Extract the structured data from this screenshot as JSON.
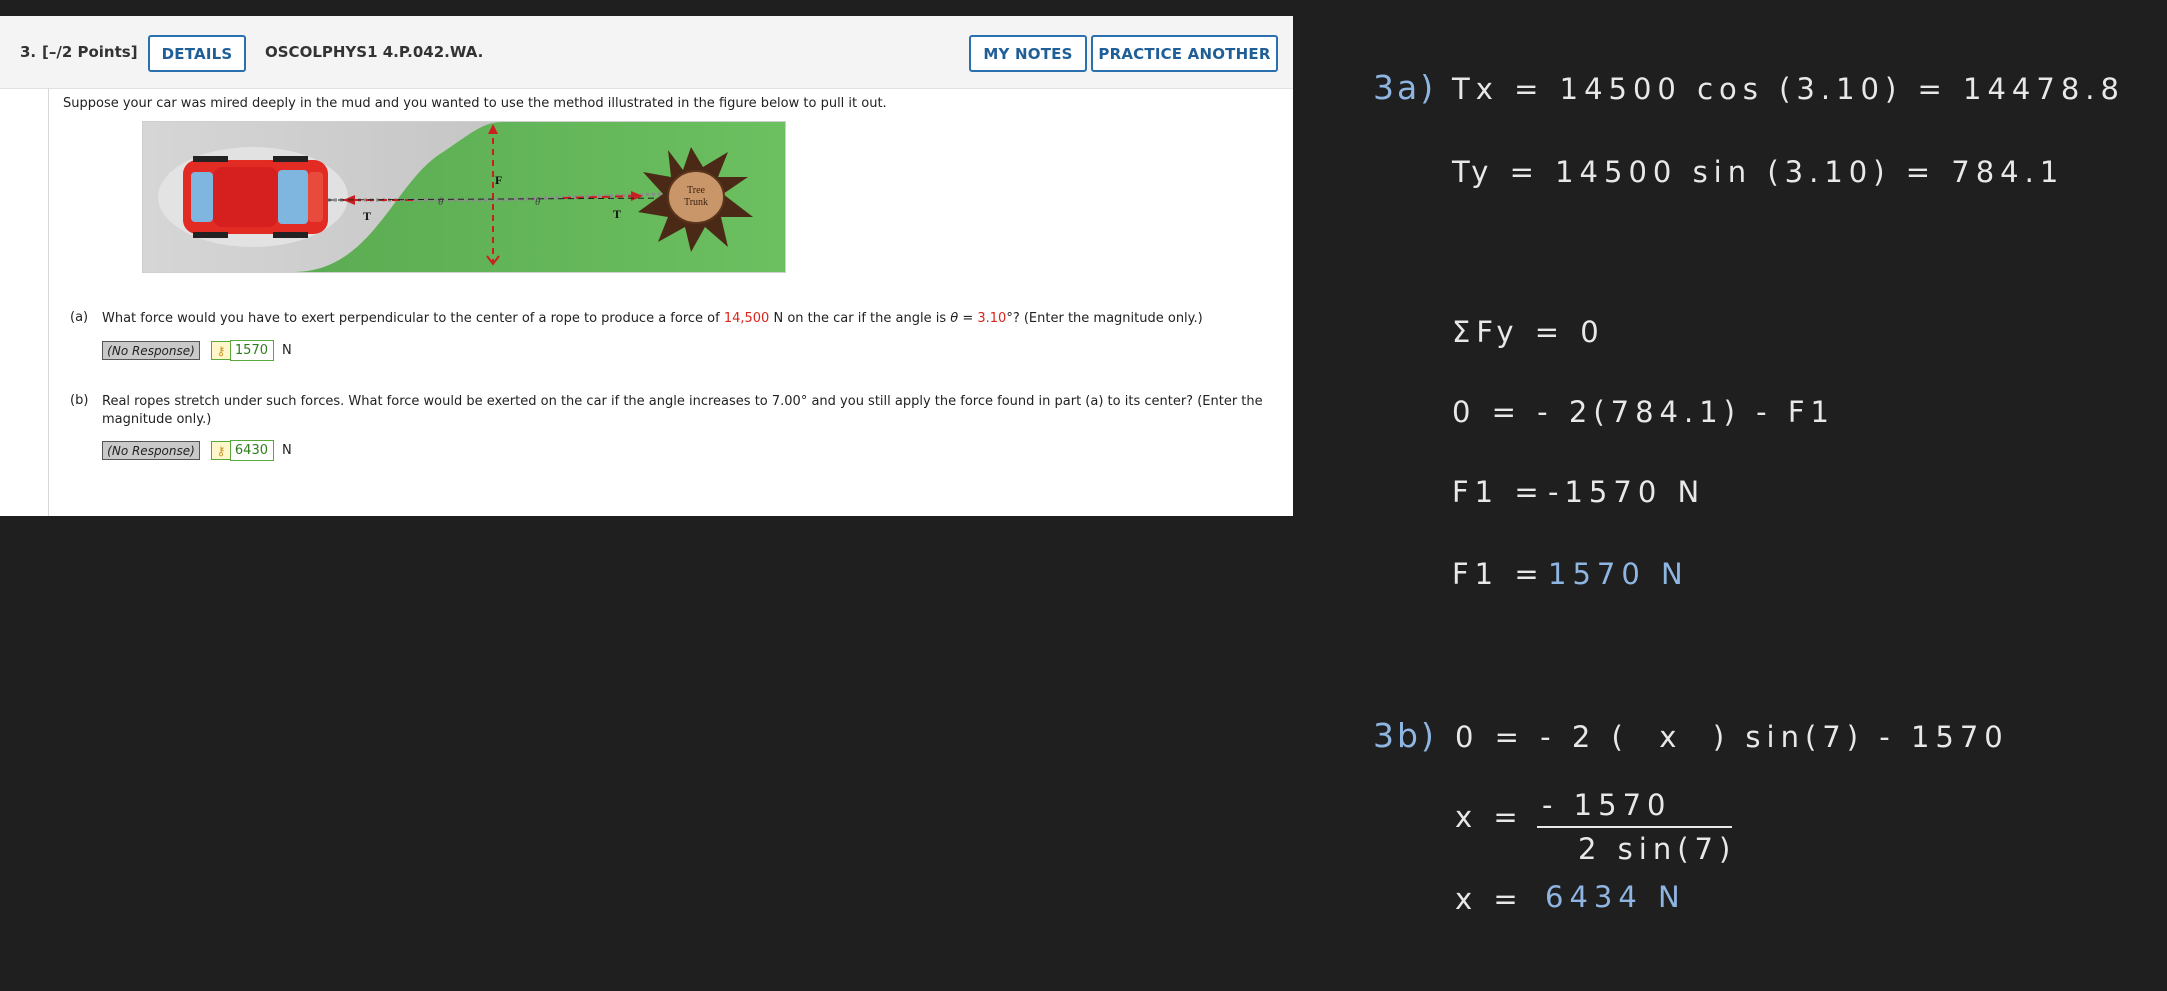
{
  "question": {
    "number": "3.",
    "points": "[–/2 Points]",
    "details_label": "DETAILS",
    "code": "OSCOLPHYS1 4.P.042.WA.",
    "my_notes_label": "MY NOTES",
    "practice_label": "PRACTICE ANOTHER",
    "intro": "Suppose your car was mired deeply in the mud and you wanted to use the method illustrated in the figure below to pull it out.",
    "figure": {
      "tree_label_1": "Tree",
      "tree_label_2": "Trunk",
      "t_label": "T",
      "f_label": "F",
      "theta": "θ"
    },
    "part_a": {
      "label": "(a)",
      "text_1": "What force would you have to exert perpendicular to the center of a rope to produce a force of ",
      "force_value": "14,500",
      "text_2": " N on the car if the angle is ",
      "theta_text": "θ = ",
      "angle_value": "3.10",
      "text_3": "°? (Enter the magnitude only.)",
      "no_response": "(No Response)",
      "answer": "1570",
      "unit": "N"
    },
    "part_b": {
      "label": "(b)",
      "text": "Real ropes stretch under such forces. What force would be exerted on the car if the angle increases to 7.00° and you still apply the force found in part (a) to its center? (Enter the magnitude only.)",
      "no_response": "(No Response)",
      "answer": "6430",
      "unit": "N"
    }
  },
  "notes": {
    "label_3a": "3a)",
    "line1": "Tx = 14500 cos (3.10) = 14478.8",
    "line2": "Ty = 14500 sin (3.10) = 784.1",
    "line3": "ΣFy = 0",
    "line4": "0 = - 2(784.1) - F1",
    "line5_left": "F1 = ",
    "line5_right": "-1570 N",
    "line6_left": "F1 = ",
    "line6_right": "1570 N",
    "label_3b": "3b)",
    "line7": "0 = - 2 (  x  ) sin(7) - 1570",
    "line8_left": "x = ",
    "line8_num": "- 1570",
    "line8_den": "2 sin(7)",
    "line9_left": "x = ",
    "line9_right": "6434 N"
  },
  "colors": {
    "accent": "#2a6fae",
    "answer_green": "#2f7d1c",
    "red": "#d8261c",
    "handwriting_blue": "#8fb6e2",
    "background": "#1f1f1f"
  }
}
